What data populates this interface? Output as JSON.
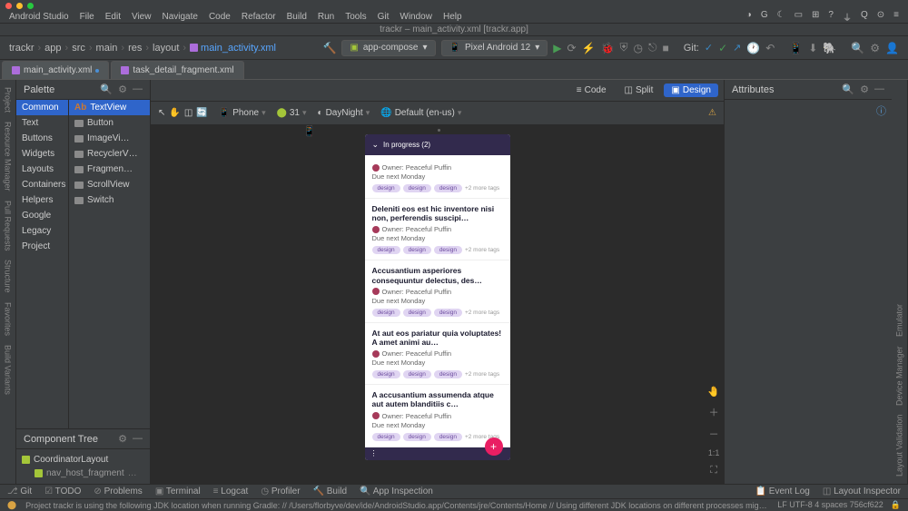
{
  "menu": {
    "items": [
      "Android Studio",
      "File",
      "Edit",
      "View",
      "Navigate",
      "Code",
      "Refactor",
      "Build",
      "Run",
      "Tools",
      "Git",
      "Window",
      "Help"
    ]
  },
  "project_title": "trackr – main_activity.xml [trackr.app]",
  "breadcrumbs": [
    "trackr",
    "app",
    "src",
    "main",
    "res",
    "layout"
  ],
  "breadcrumb_file": "main_activity.xml",
  "run": {
    "config": "app-compose",
    "device": "Pixel Android 12",
    "git_label": "Git:"
  },
  "tabs": [
    {
      "name": "main_activity.xml",
      "active": true
    },
    {
      "name": "task_detail_fragment.xml",
      "active": false
    }
  ],
  "left_tools": [
    "Project",
    "Resource Manager",
    "Pull Requests",
    "Structure",
    "Favorites",
    "Build Variants"
  ],
  "right_tools": [
    "Layout Validation",
    "Device Manager",
    "Emulator"
  ],
  "palette": {
    "title": "Palette",
    "categories": [
      "Common",
      "Text",
      "Buttons",
      "Widgets",
      "Layouts",
      "Containers",
      "Helpers",
      "Google",
      "Legacy",
      "Project"
    ],
    "items": [
      "TextView",
      "Button",
      "ImageVi…",
      "RecyclerV…",
      "Fragmen…",
      "ScrollView",
      "Switch"
    ]
  },
  "component_tree": {
    "title": "Component Tree",
    "root": "CoordinatorLayout",
    "child": "nav_host_fragment",
    "child_suffix": "…"
  },
  "design_modes": {
    "code": "Code",
    "split": "Split",
    "design": "Design"
  },
  "design_toolbar": {
    "device": "Phone",
    "api": "31",
    "theme": "DayNight",
    "locale": "Default (en-us)"
  },
  "attributes": {
    "title": "Attributes"
  },
  "preview": {
    "header": "In progress (2)",
    "cards": [
      {
        "title": "",
        "owner": "Owner: Peaceful Puffin",
        "due": "Due next Monday",
        "tag": "design",
        "more": "+2 more tags"
      },
      {
        "title": "Deleniti eos est hic inventore nisi non, perferendis suscipi…",
        "owner": "Owner: Peaceful Puffin",
        "due": "Due next Monday",
        "tag": "design",
        "more": "+2 more tags"
      },
      {
        "title": "Accusantium asperiores consequuntur delectus, des…",
        "owner": "Owner: Peaceful Puffin",
        "due": "Due next Monday",
        "tag": "design",
        "more": "+2 more tags"
      },
      {
        "title": "At aut eos pariatur quia voluptates! A amet animi au…",
        "owner": "Owner: Peaceful Puffin",
        "due": "Due next Monday",
        "tag": "design",
        "more": "+2 more tags"
      },
      {
        "title": "A accusantium assumenda atque aut autem blanditiis c…",
        "owner": "Owner: Peaceful Puffin",
        "due": "Due next Monday",
        "tag": "design",
        "more": "+2 more tags"
      }
    ],
    "fab": "+",
    "zoom_1to1": "1:1"
  },
  "bottom_tools": {
    "left": [
      "Git",
      "TODO",
      "Problems",
      "Terminal",
      "Logcat",
      "Profiler",
      "Build",
      "App Inspection"
    ],
    "right": [
      "Event Log",
      "Layout Inspector"
    ]
  },
  "status": {
    "msg": "Project trackr is using the following JDK location when running Gradle: // /Users/florbyve/dev/ide/AndroidStudio.app/Contents/jre/Contents/Home // Using different JDK locations on different processes mig… (a minute ago)",
    "encoding": "LF   UTF-8   4 spaces   756cf622"
  }
}
